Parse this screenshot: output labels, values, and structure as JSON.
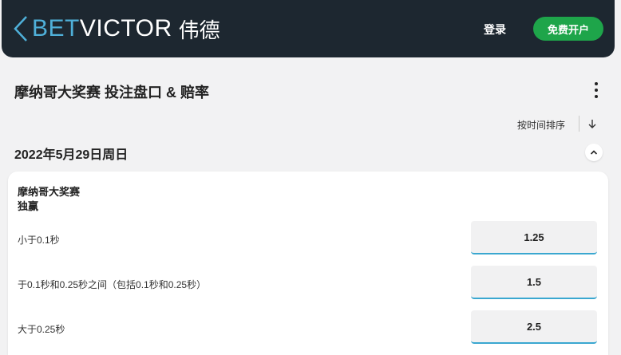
{
  "header": {
    "logo_bet": "BET",
    "logo_victor": "VICTOR",
    "logo_cn": "伟德",
    "login_label": "登录",
    "signup_label": "免费开户"
  },
  "page": {
    "title": "摩纳哥大奖赛 投注盘口 & 赔率",
    "sort_label": "按时间排序",
    "date": "2022年5月29日周日"
  },
  "market": {
    "event": "摩纳哥大奖赛",
    "name": "独赢",
    "selections": [
      {
        "label": "小于0.1秒",
        "odds": "1.25"
      },
      {
        "label": "于0.1秒和0.25秒之间（包括0.1秒和0.25秒）",
        "odds": "1.5"
      },
      {
        "label": "大于0.25秒",
        "odds": "2.5"
      }
    ]
  },
  "colors": {
    "header_bg": "#1d2730",
    "brand_blue": "#4fb0d9",
    "signup_green": "#1ea54a",
    "odds_underline": "#3aa7d0"
  }
}
